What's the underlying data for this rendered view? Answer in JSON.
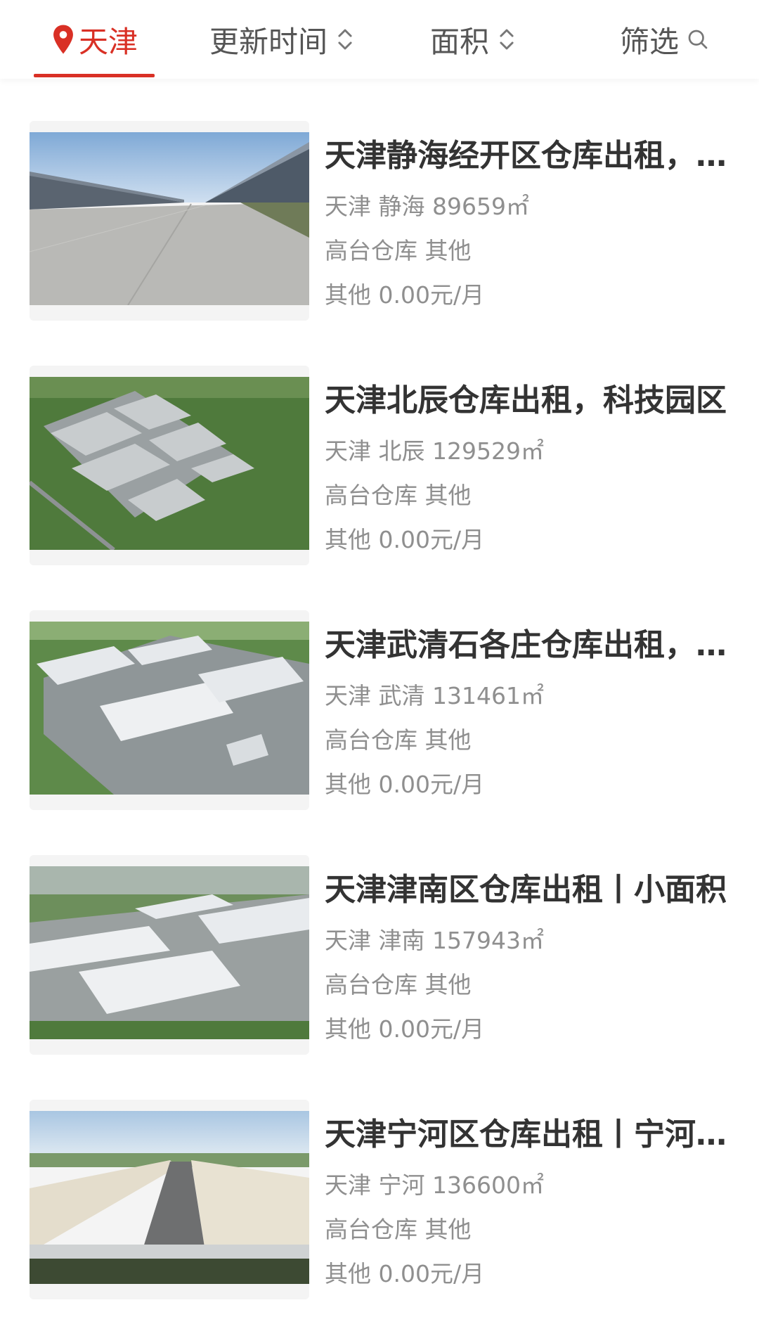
{
  "filter_bar": {
    "city": "天津",
    "sort_time": "更新时间",
    "sort_area": "面积",
    "filter": "筛选"
  },
  "colors": {
    "accent": "#d93025",
    "title_text": "#333333",
    "meta_text": "#8f8f8f"
  },
  "listings": [
    {
      "title": "天津静海经开区仓库出租，现房",
      "location": "天津 静海 89659㎡",
      "type": "高台仓库 其他",
      "price": "其他 0.00元/月",
      "image_icon": "warehouse-yard-photo"
    },
    {
      "title": "天津北辰仓库出租，科技园区",
      "location": "天津 北辰 129529㎡",
      "type": "高台仓库 其他",
      "price": "其他 0.00元/月",
      "image_icon": "warehouse-aerial-photo"
    },
    {
      "title": "天津武清石各庄仓库出租，高标库",
      "location": "天津 武清 131461㎡",
      "type": "高台仓库 其他",
      "price": "其他 0.00元/月",
      "image_icon": "warehouse-aerial-photo"
    },
    {
      "title": "天津津南区仓库出租丨小面积",
      "location": "天津 津南 157943㎡",
      "type": "高台仓库 其他",
      "price": "其他 0.00元/月",
      "image_icon": "warehouse-aerial-photo"
    },
    {
      "title": "天津宁河区仓库出租丨宁河物流园",
      "location": "天津 宁河 136600㎡",
      "type": "高台仓库 其他",
      "price": "其他 0.00元/月",
      "image_icon": "warehouse-aerial-photo"
    }
  ]
}
